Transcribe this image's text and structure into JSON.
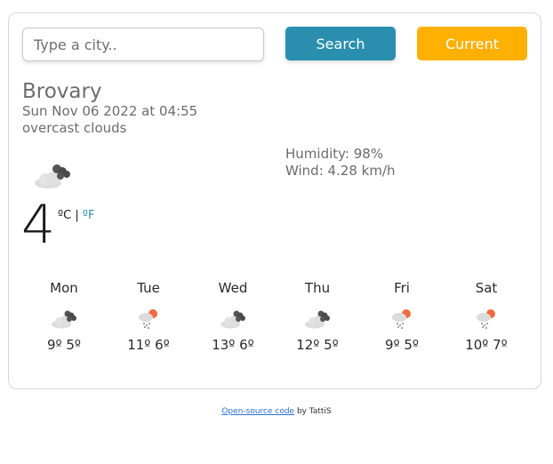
{
  "search": {
    "placeholder": "Type a city.."
  },
  "buttons": {
    "search_label": "Search",
    "current_label": "Current"
  },
  "weather": {
    "city": "Brovary",
    "date": "Sun Nov 06 2022 at 04:55",
    "description": "overcast clouds",
    "humidity": "Humidity: 98%",
    "wind": "Wind: 4.28 km/h",
    "temperature": "4",
    "unit_c": "ºC",
    "unit_sep": " | ",
    "unit_f": "ºF",
    "icon": "overcast-clouds-icon"
  },
  "forecast": [
    {
      "day": "Mon",
      "temps": "9º 5º",
      "icon": "overcast-clouds-icon"
    },
    {
      "day": "Tue",
      "temps": "11º 6º",
      "icon": "rain-sun-icon"
    },
    {
      "day": "Wed",
      "temps": "13º 6º",
      "icon": "overcast-clouds-icon"
    },
    {
      "day": "Thu",
      "temps": "12º 5º",
      "icon": "overcast-clouds-icon"
    },
    {
      "day": "Fri",
      "temps": "9º 5º",
      "icon": "rain-sun-icon"
    },
    {
      "day": "Sat",
      "temps": "10º 7º",
      "icon": "rain-sun-icon"
    }
  ],
  "footer": {
    "link_text": "Open-source code",
    "suffix": " by TattiS"
  },
  "colors": {
    "accent": "#2a8fae",
    "current": "#ffb000"
  }
}
